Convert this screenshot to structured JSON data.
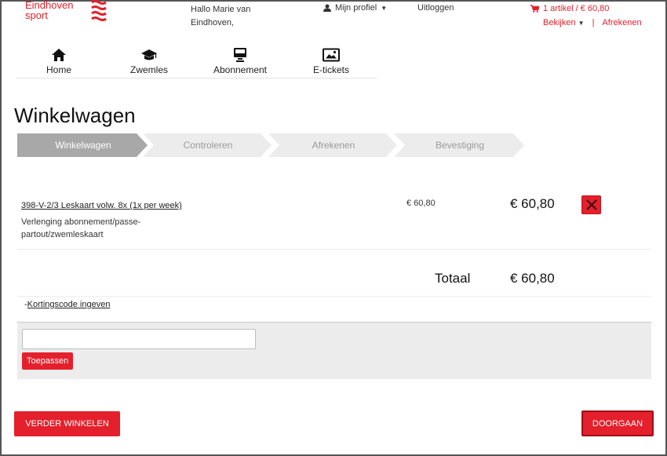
{
  "header": {
    "logo_line1": "Eindhoven",
    "logo_line2": "sport",
    "greeting_line1": "Hallo Marie van",
    "greeting_line2": "Eindhoven,",
    "profile_label": "Mijn profiel",
    "logout_label": "Uitloggen",
    "cart_summary": "1 artikel / € 60,80",
    "view_label": "Bekijken",
    "checkout_link": "Afrekenen",
    "separator": "|"
  },
  "nav": {
    "items": [
      {
        "label": "Home",
        "icon": "home-icon"
      },
      {
        "label": "Zwemles",
        "icon": "graduation-cap-icon"
      },
      {
        "label": "Abonnement",
        "icon": "card-icon"
      },
      {
        "label": "E-tickets",
        "icon": "image-icon"
      }
    ]
  },
  "page": {
    "title": "Winkelwagen"
  },
  "steps": [
    {
      "label": "Winkelwagen",
      "active": true
    },
    {
      "label": "Controleren",
      "active": false
    },
    {
      "label": "Afrekenen",
      "active": false
    },
    {
      "label": "Bevestiging",
      "active": false
    }
  ],
  "cart": {
    "item": {
      "name": "398-V-2/3 Leskaart volw. 8x (1x per week)",
      "description": "Verlenging abonnement/passe-partout/zwemleskaart",
      "unit_price": "€ 60,80",
      "price": "€ 60,80"
    },
    "total_label": "Totaal",
    "total_value": "€ 60,80"
  },
  "discount": {
    "toggle_symbol": "-",
    "toggle_label": "Kortingscode ingeven",
    "input_value": "",
    "apply_label": "Toepassen"
  },
  "footer": {
    "continue_label": "VERDER WINKELEN",
    "checkout_label": "DOORGAAN"
  },
  "colors": {
    "accent": "#e4202c",
    "step_active": "#a8a8a8",
    "step_inactive": "#ececec"
  }
}
